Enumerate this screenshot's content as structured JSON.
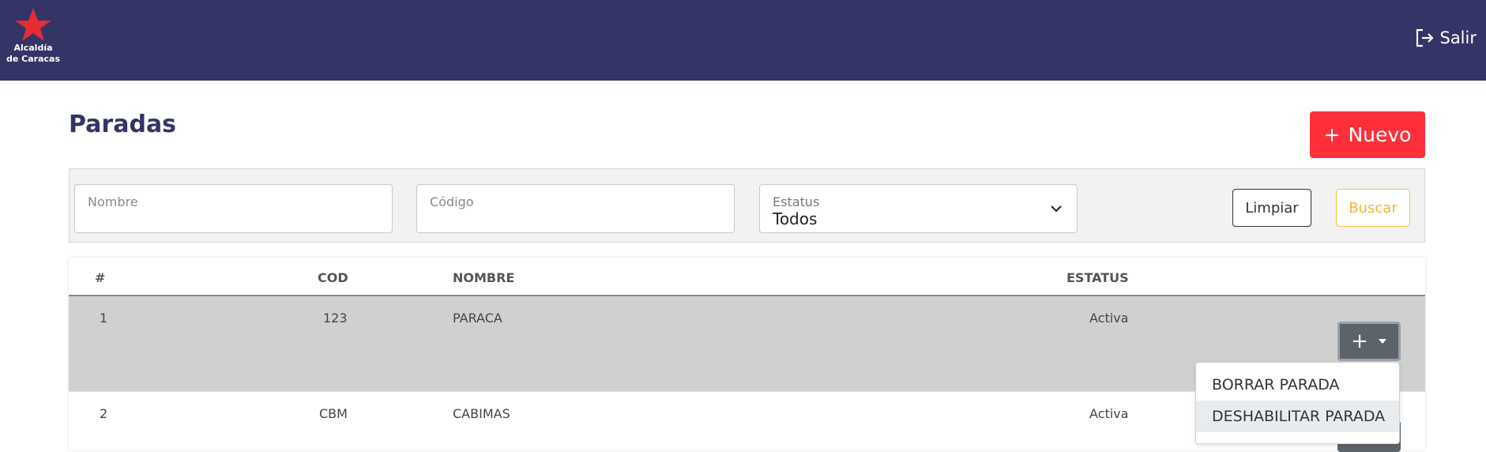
{
  "header": {
    "logo_line1": "Alcaldía",
    "logo_line2": "de Caracas",
    "logout_label": "Salir"
  },
  "page": {
    "title": "Paradas",
    "new_button_label": "Nuevo",
    "new_button_icon": "+"
  },
  "filters": {
    "nombre_placeholder": "Nombre",
    "codigo_placeholder": "Código",
    "estatus_label": "Estatus",
    "estatus_value": "Todos",
    "clear_label": "Limpiar",
    "search_label": "Buscar"
  },
  "table": {
    "headers": [
      "#",
      "COD",
      "NOMBRE",
      "ESTATUS"
    ],
    "rows": [
      {
        "num": "1",
        "cod": "123",
        "nombre": "PARACA",
        "estatus": "Activa"
      },
      {
        "num": "2",
        "cod": "CBM",
        "nombre": "CABIMAS",
        "estatus": "Activa"
      }
    ]
  },
  "actions_menu": {
    "button_icon": "+",
    "items": [
      "BORRAR PARADA",
      "DESHABILITAR PARADA"
    ]
  },
  "colors": {
    "header_bg": "#343466",
    "accent_red": "#ff2f3a",
    "search_yellow": "#f0b72f",
    "selected_row": "#d0d0d0"
  }
}
